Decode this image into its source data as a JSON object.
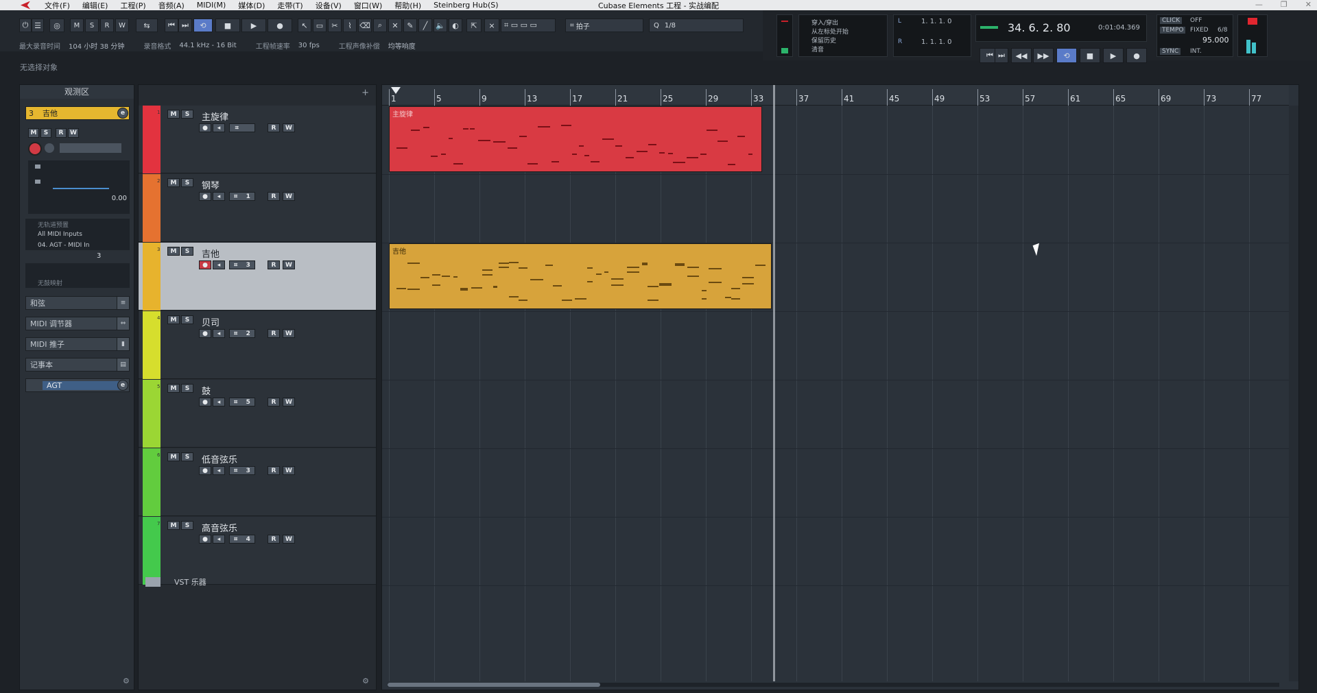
{
  "menu": {
    "items": [
      "文件(F)",
      "编辑(E)",
      "工程(P)",
      "音频(A)",
      "MIDI(M)",
      "媒体(D)",
      "走带(T)",
      "设备(V)",
      "窗口(W)",
      "帮助(H)",
      "Steinberg Hub(S)"
    ],
    "window_title": "Cubase Elements 工程 - 实战编配"
  },
  "toolbar": {
    "buttons_ms": [
      "M",
      "S",
      "R",
      "W"
    ],
    "snap_label": "拍子",
    "quantize_value": "1/8",
    "quantize_label": "Q"
  },
  "statusline": {
    "max_record_label": "最大录音时间",
    "max_record_value": "104 小时 38 分钟",
    "rec_format_label": "录音格式",
    "rec_format_value": "44.1 kHz - 16 Bit",
    "framerate_label": "工程帧速率",
    "framerate_value": "30 fps",
    "pan_label": "工程声像补偿",
    "pan_value": "均等响度"
  },
  "info": {
    "no_selection": "无选择对象"
  },
  "transport": {
    "left_labels": [
      "穿入/穿出",
      "从左标处开始",
      "保留历史",
      "清音"
    ],
    "left_locator": "1. 1. 1.  0",
    "right_locator": "1. 1. 1.  0",
    "position_bars": "34.  6.  2.  80",
    "position_time": "0:01:04.369",
    "click_label": "CLICK",
    "click_value": "OFF",
    "tempo_label": "TEMPO",
    "tempo_mode": "FIXED",
    "signature": "6/8",
    "tempo_value": "95.000",
    "sync_label": "SYNC",
    "sync_value": "INT."
  },
  "inspector": {
    "title": "观测区",
    "track_number": "3",
    "track_name": "吉他",
    "volume_value": "0.00",
    "input_label": "无轨道预置",
    "midi_input": "All MIDI Inputs",
    "midi_output": "04. AGT - MIDI In",
    "channel": "3",
    "no_drum_map": "无鼓映射",
    "sections": [
      "和弦",
      "MIDI 调节器",
      "MIDI 推子",
      "记事本"
    ],
    "instrument": "AGT"
  },
  "tracks": [
    {
      "num": "1",
      "name": "主旋律",
      "color": "#e3333f",
      "channel": "",
      "selected": false
    },
    {
      "num": "2",
      "name": "钢琴",
      "color": "#e57230",
      "channel": "1",
      "selected": false
    },
    {
      "num": "3",
      "name": "吉他",
      "color": "#e7b32d",
      "channel": "3",
      "selected": true
    },
    {
      "num": "4",
      "name": "贝司",
      "color": "#d6de2d",
      "channel": "2",
      "selected": false
    },
    {
      "num": "5",
      "name": "鼓",
      "color": "#9bd634",
      "channel": "5",
      "selected": false
    },
    {
      "num": "6",
      "name": "低音弦乐",
      "color": "#62cc3e",
      "channel": "3",
      "selected": false
    },
    {
      "num": "7",
      "name": "高音弦乐",
      "color": "#44c94c",
      "channel": "4",
      "selected": false
    }
  ],
  "vst_folder": "VST 乐器",
  "ruler": {
    "labels": [
      "1",
      "5",
      "9",
      "13",
      "17",
      "21",
      "25",
      "29",
      "33",
      "37",
      "41",
      "45",
      "49",
      "53",
      "57",
      "61",
      "65",
      "69",
      "73",
      "77"
    ]
  },
  "parts": [
    {
      "label": "主旋律",
      "color": "#d93a43",
      "label_color": "#f4c9cc"
    },
    {
      "label": "吉他",
      "color": "#d7a33b",
      "label_color": "#3a2a08"
    }
  ]
}
